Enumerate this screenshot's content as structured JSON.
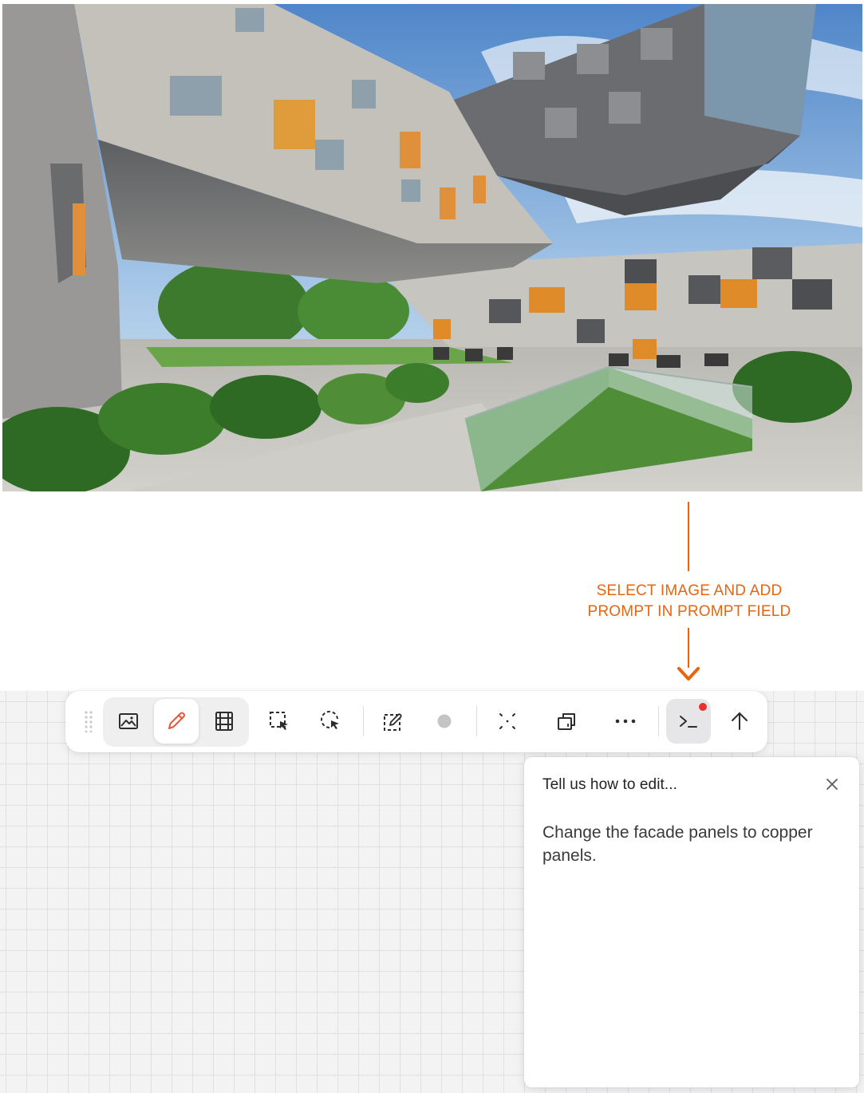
{
  "annotation": {
    "line1": "SELECT IMAGE AND ADD",
    "line2": "PROMPT IN PROMPT FIELD",
    "color": "#e8650e"
  },
  "photo": {
    "subject": "modern building with grey and orange facade panels"
  },
  "toolbar": {
    "buttons": [
      {
        "icon": "image-icon",
        "state": "default"
      },
      {
        "icon": "pencil-icon",
        "state": "active"
      },
      {
        "icon": "film-icon",
        "state": "default"
      },
      {
        "icon": "rect-select-icon",
        "state": "default"
      },
      {
        "icon": "lasso-select-icon",
        "state": "default"
      },
      {
        "icon": "edit-region-icon",
        "state": "default"
      },
      {
        "icon": "brush-dot-icon",
        "state": "default"
      },
      {
        "icon": "expand-icon",
        "state": "default"
      },
      {
        "icon": "crop-ratio-icon",
        "state": "default"
      },
      {
        "icon": "more-icon",
        "state": "default"
      },
      {
        "icon": "prompt-terminal-icon",
        "state": "active",
        "notification": true
      },
      {
        "icon": "upload-arrow-icon",
        "state": "default"
      }
    ],
    "pencil_color": "#e8553a",
    "notification_color": "#e8322c"
  },
  "prompt_panel": {
    "title": "Tell us how to edit...",
    "value": "Change the facade panels to copper panels."
  }
}
